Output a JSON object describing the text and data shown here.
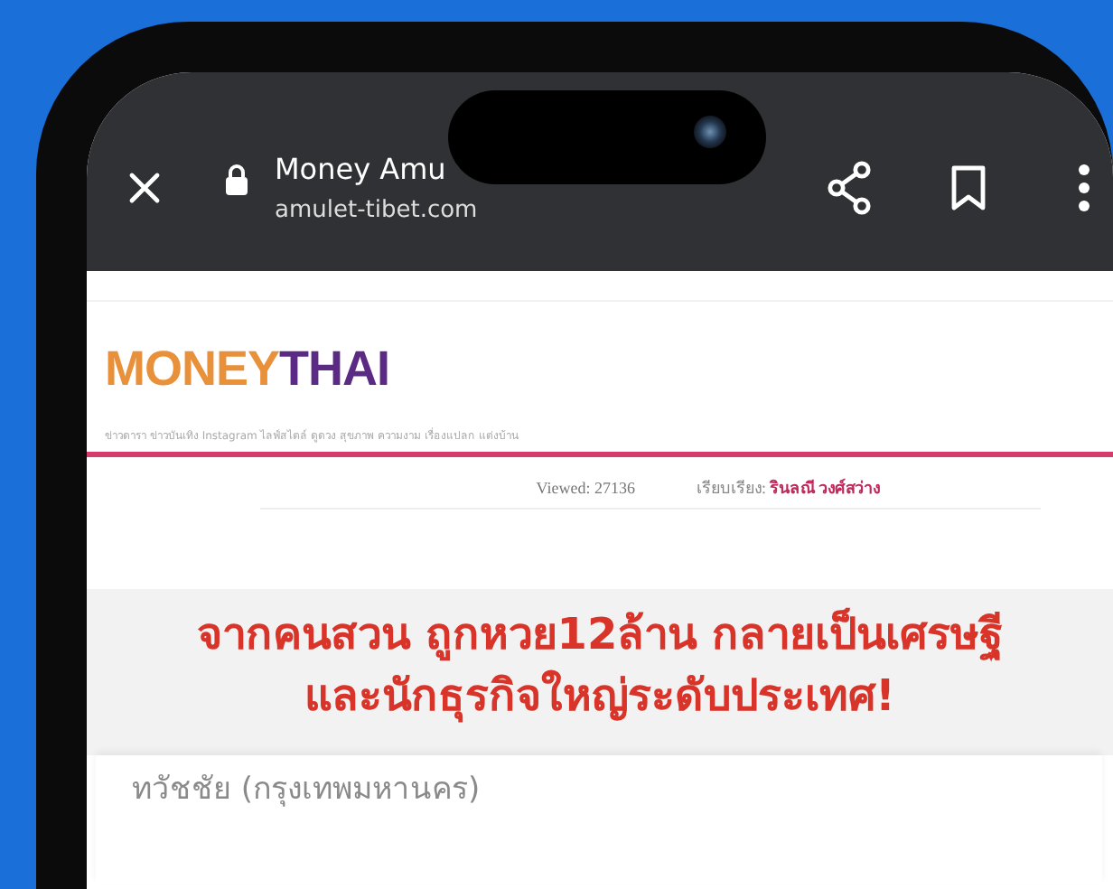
{
  "browser": {
    "title": "Money Amu",
    "url": "amulet-tibet.com"
  },
  "site": {
    "logo": [
      {
        "text": "MONEY",
        "color": "#e8913a"
      },
      {
        "text": "THAI",
        "color": "#5a2a84"
      }
    ],
    "nav": "ข่าวดารา ข่าวบันเทิง Instagram ไลฟ์สไตล์ ดูดวง สุขภาพ ความงาม เรื่องแปลก แต่งบ้าน"
  },
  "article": {
    "views": "Viewed: 27136",
    "author_label": "เรียบเรียง:",
    "author": "รินลณี วงศ์สว่าง",
    "headline": [
      "จากคนสวน ถูกหวย12ล้าน กลายเป็นเศรษฐี",
      "และนักธุรกิจใหญ่ระดับประเทศ!"
    ],
    "byline": "ทวัชชัย (กรุงเทพมหานคร)"
  }
}
